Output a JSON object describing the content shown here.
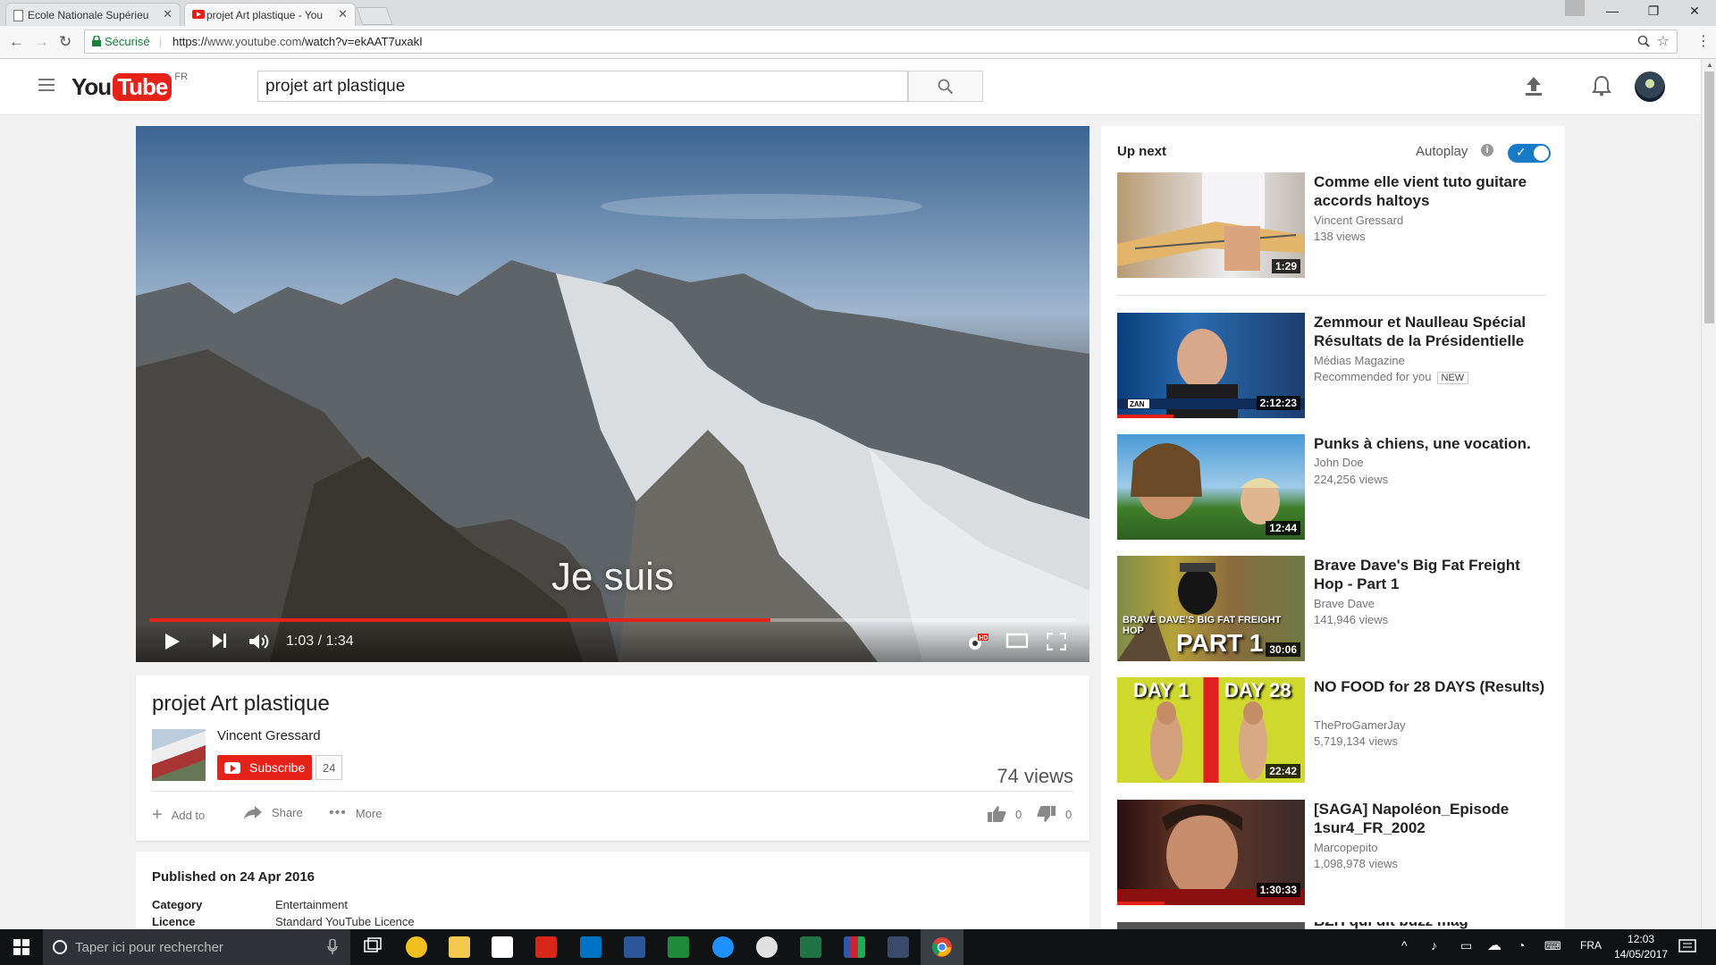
{
  "browser": {
    "tabs": [
      {
        "label": "Ecole Nationale Supérieu",
        "active": false
      },
      {
        "label": "projet Art plastique - You",
        "active": true
      }
    ],
    "secure_label": "Sécurisé",
    "url_prefix": "https://",
    "url_host": "www.youtube.com",
    "url_path": "/watch?v=ekAAT7uxakI"
  },
  "header": {
    "logo_you": "You",
    "logo_tube": "Tube",
    "logo_region": "FR",
    "search_value": "projet art plastique"
  },
  "player": {
    "caption": "Je suis",
    "current_time": "1:03",
    "duration": "1:34",
    "progress_fraction": 0.67
  },
  "video": {
    "title": "projet Art plastique",
    "channel": "Vincent Gressard",
    "subscribe_label": "Subscribe",
    "subscriber_count": "24",
    "views": "74 views",
    "actions": {
      "add_to": "Add to",
      "share": "Share",
      "more": "More"
    },
    "likes": "0",
    "dislikes": "0"
  },
  "description": {
    "published": "Published on 24 Apr 2016",
    "category_label": "Category",
    "category_value": "Entertainment",
    "licence_label": "Licence",
    "licence_value": "Standard YouTube Licence"
  },
  "sidebar": {
    "up_next": "Up next",
    "autoplay": "Autoplay",
    "autoplay_on": true,
    "items": [
      {
        "title": "Comme elle vient tuto guitare accords haltoys",
        "channel": "Vincent Gressard",
        "views": "138 views",
        "duration": "1:29"
      },
      {
        "title": "Zemmour et Naulleau Spécial Résultats de la Présidentielle",
        "channel": "Médias Magazine",
        "views": "Recommended for you",
        "badge": "NEW",
        "duration": "2:12:23",
        "watched_fraction": 0.3
      },
      {
        "title": "Punks à chiens, une vocation.",
        "channel": "John Doe",
        "views": "224,256 views",
        "duration": "12:44"
      },
      {
        "title": "Brave Dave's Big Fat Freight Hop - Part 1",
        "channel": "Brave Dave",
        "views": "141,946 views",
        "duration": "30:06",
        "thumb_text1": "BRAVE DAVE'S BIG FAT FREIGHT HOP",
        "thumb_text2": "PART 1"
      },
      {
        "title": "NO FOOD for 28 DAYS (Results)",
        "channel": "TheProGamerJay",
        "views": "5,719,134 views",
        "duration": "22:42",
        "thumb_text1": "DAY 1",
        "thumb_text2": "DAY 28"
      },
      {
        "title": "[SAGA] Napoléon_Episode 1sur4_FR_2002",
        "channel": "Marcopepito",
        "views": "1,098,978 views",
        "duration": "1:30:33",
        "watched_fraction": 0.25
      },
      {
        "title": "BZH qui dit buzz mag"
      }
    ]
  },
  "taskbar": {
    "search_placeholder": "Taper ici pour rechercher",
    "language": "FRA",
    "time": "12:03",
    "date": "14/05/2017"
  },
  "colors": {
    "accent_red": "#e62117",
    "autoplay_blue": "#167ac6",
    "taskbar_bg": "#101214"
  }
}
